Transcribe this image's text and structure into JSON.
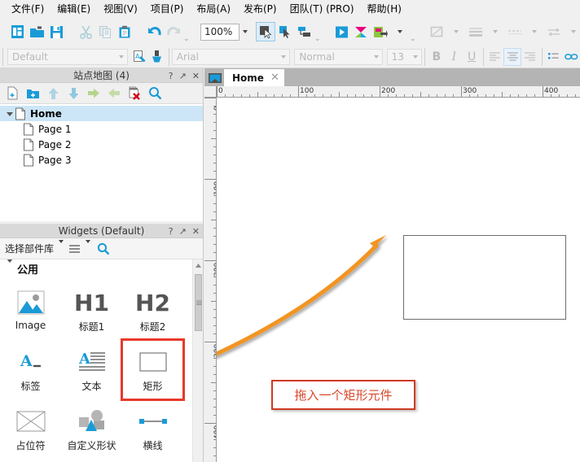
{
  "menubar": {
    "items": [
      {
        "label": "文件(F)",
        "name": "menu-file"
      },
      {
        "label": "编辑(E)",
        "name": "menu-edit"
      },
      {
        "label": "视图(V)",
        "name": "menu-view"
      },
      {
        "label": "项目(P)",
        "name": "menu-project"
      },
      {
        "label": "布局(A)",
        "name": "menu-layout"
      },
      {
        "label": "发布(P)",
        "name": "menu-publish"
      },
      {
        "label": "团队(T) (PRO)",
        "name": "menu-team"
      },
      {
        "label": "帮助(H)",
        "name": "menu-help"
      }
    ]
  },
  "toolbar": {
    "new_icon": "new-file-icon",
    "open_icon": "open-folder-icon",
    "save_icon": "save-icon",
    "cut_icon": "cut-icon",
    "copy_icon": "copy-icon",
    "paste_icon": "paste-icon",
    "undo_icon": "undo-icon",
    "redo_icon": "redo-icon",
    "zoom_value": "100%",
    "zoom_caret": "chevron-down-icon",
    "select_icon": "select-arrow-icon",
    "connector_icon": "connector-arrow-icon",
    "pointer_group_icon": "group-select-icon",
    "preview_icon": "preview-icon",
    "publish_icon": "publish-icon",
    "generate_icon": "generate-html-icon",
    "overflow_icon": "overflow-chevron-icon"
  },
  "stylebar": {
    "style_value": "Default",
    "style_placeholder": "Default",
    "format_painter_icon": "format-painter-icon",
    "brush_icon": "brush-icon",
    "font_value": "Arial",
    "weight_value": "Normal",
    "size_value": "13",
    "bold_label": "B",
    "italic_label": "I",
    "underline_label": "U",
    "align_left_icon": "align-left-icon",
    "align_center_icon": "align-center-icon",
    "align_right_icon": "align-right-icon",
    "list_icon": "bullet-list-icon",
    "link_icon": "link-icon",
    "line_style_icon": "line-style-icon",
    "line_width_icon": "line-width-icon",
    "line_dash_icon": "line-dash-icon",
    "arrow_style_icon": "arrow-style-icon",
    "fill_icon": "fill-color-icon",
    "shadow_icon": "shadow-icon"
  },
  "sitemap": {
    "title": "站点地图 (4)",
    "help_icon": "?",
    "popout_icon": "↗",
    "close_icon": "✕",
    "tools": [
      {
        "name": "add-page-icon",
        "label": "add-page"
      },
      {
        "name": "add-folder-icon",
        "label": "add-folder"
      },
      {
        "name": "move-up-icon",
        "label": "move-up"
      },
      {
        "name": "move-down-icon",
        "label": "move-down"
      },
      {
        "name": "indent-icon",
        "label": "indent"
      },
      {
        "name": "outdent-icon",
        "label": "outdent"
      },
      {
        "name": "delete-page-icon",
        "label": "delete"
      },
      {
        "name": "search-icon",
        "label": "search"
      }
    ],
    "tree": [
      {
        "label": "Home",
        "level": 0,
        "selected": true,
        "expanded": true
      },
      {
        "label": "Page 1",
        "level": 1,
        "selected": false,
        "expanded": false
      },
      {
        "label": "Page 2",
        "level": 1,
        "selected": false,
        "expanded": false
      },
      {
        "label": "Page 3",
        "level": 1,
        "selected": false,
        "expanded": false
      }
    ]
  },
  "widgets": {
    "title": "Widgets (Default)",
    "help_icon": "?",
    "popout_icon": "↗",
    "close_icon": "✕",
    "library_label": "选择部件库",
    "library_caret": "chevron-down-icon",
    "menu_icon": "hamburger-menu-icon",
    "menu_caret": "chevron-down-icon",
    "search_icon": "search-icon",
    "category": "公用",
    "category_caret": "triangle-down-icon",
    "items": [
      {
        "caption": "Image",
        "icon": "image-widget-icon",
        "highlight": false
      },
      {
        "caption": "标题1",
        "icon": "heading1-widget-icon",
        "highlight": false
      },
      {
        "caption": "标题2",
        "icon": "heading2-widget-icon",
        "highlight": false
      },
      {
        "caption": "标签",
        "icon": "label-widget-icon",
        "highlight": false
      },
      {
        "caption": "文本",
        "icon": "paragraph-widget-icon",
        "highlight": false
      },
      {
        "caption": "矩形",
        "icon": "rectangle-widget-icon",
        "highlight": true
      },
      {
        "caption": "占位符",
        "icon": "placeholder-widget-icon",
        "highlight": false
      },
      {
        "caption": "自定义形状",
        "icon": "custom-shape-widget-icon",
        "highlight": false
      },
      {
        "caption": "横线",
        "icon": "horizontal-line-widget-icon",
        "highlight": false
      }
    ],
    "heading1_text": "H1",
    "heading2_text": "H2",
    "label_glyph": "A",
    "text_glyph": "A"
  },
  "canvas": {
    "tab_icon": "page-tab-icon",
    "tab_label": "Home",
    "tab_close": "✕",
    "ruler_h_labels": [
      "0",
      "100",
      "200",
      "300",
      "400"
    ],
    "ruler_v_labels": [
      "0",
      "100",
      "200",
      "300",
      "400"
    ],
    "annotation_text": "拖入一个矩形元件",
    "annotation_border_color": "#cf3a22",
    "annotation_text_color": "#d9482a",
    "arrow_color": "#f29422",
    "rect_border_color": "#6e6e6e",
    "highlight_color": "#e8392b"
  }
}
